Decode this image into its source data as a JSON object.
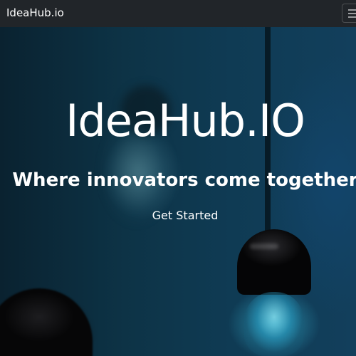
{
  "navbar": {
    "brand": "IdeaHub.io",
    "toggler_icon": "hamburger-icon"
  },
  "hero": {
    "title": "IdeaHub.IO",
    "subtitle": "Where innovators come together",
    "cta_label": "Get Started"
  },
  "colors": {
    "navbar_bg": "#212529",
    "text": "#ffffff",
    "hero_bg_dark": "#0c2a3a",
    "hero_bg_blue": "#123f5c",
    "bulb_glow": "#3cbedc"
  }
}
